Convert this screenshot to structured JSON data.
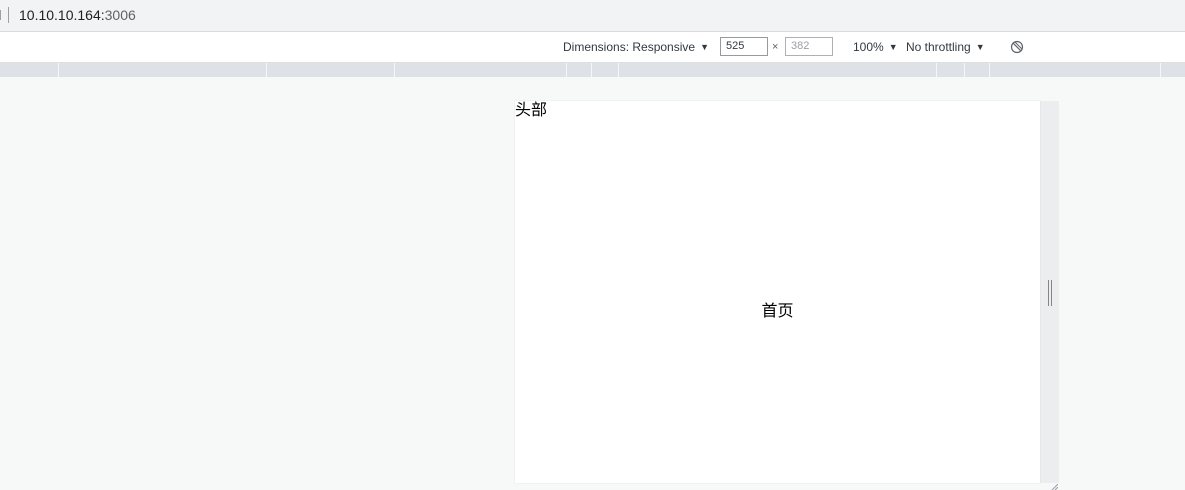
{
  "browser": {
    "url_host": "10.10.10.164:",
    "url_port": "3006"
  },
  "device_toolbar": {
    "dimensions_label": "Dimensions: Responsive",
    "width_value": "525",
    "height_placeholder": "382",
    "times_symbol": "×",
    "zoom_label": "100%",
    "throttling_label": "No throttling",
    "caret": "▼",
    "rotate_icon": "rotate-icon"
  },
  "page": {
    "header_text": "头部",
    "body_text": "首页"
  }
}
